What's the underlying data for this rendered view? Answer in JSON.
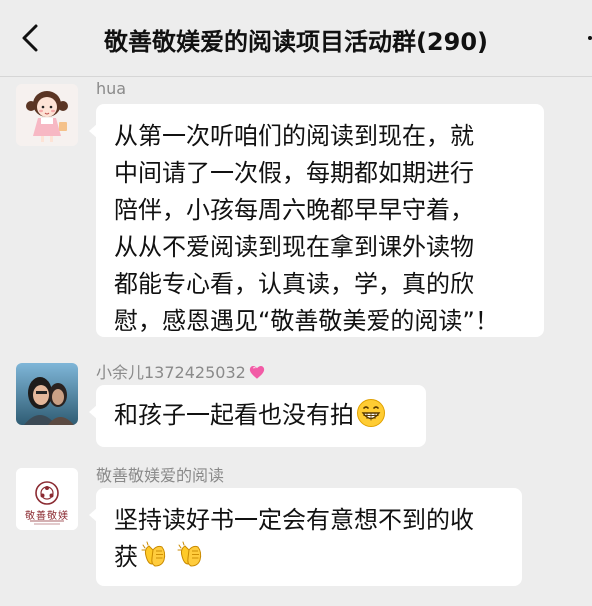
{
  "header": {
    "title": "敬善敬媄爱的阅读项目活动群(290)",
    "back_icon": "chevron-left-icon",
    "more_icon": "more-dots-icon"
  },
  "messages": [
    {
      "sender": "hua",
      "lines": [
        "从第一次听咱们的阅读到现在，就",
        "中间请了一次假，每期都如期进行",
        "陪伴，小孩每周六晚都早早守着，",
        "从从不爱阅读到现在拿到课外读物",
        "都能专心看，认真读，学，真的欣",
        "慰，感恩遇见“敬善敬美爱的阅读”！"
      ]
    },
    {
      "sender": "小余儿1372425032",
      "sender_emoji": "heart-emoji-icon",
      "text": "和孩子一起看也没有拍",
      "emoji": "grinning-face-emoji-icon"
    },
    {
      "sender": "敬善敬媄爱的阅读",
      "avatar_text": "敬善敬媄",
      "lines": [
        "坚持读好书一定会有意想不到的收",
        "获"
      ],
      "emoji": "clapping-hands-emoji-icon"
    }
  ],
  "colors": {
    "background": "#ededed",
    "bubble": "#ffffff",
    "sender_name": "#8a8a8a",
    "logo_maroon": "#8b2b32"
  }
}
